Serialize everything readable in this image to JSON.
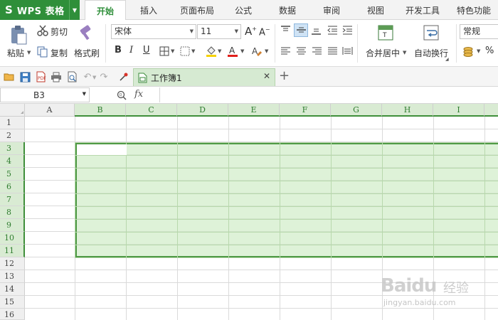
{
  "app": {
    "name": "WPS 表格",
    "logo": "S"
  },
  "menu": {
    "tabs": [
      {
        "label": "开始",
        "active": true
      },
      {
        "label": "插入"
      },
      {
        "label": "页面布局"
      },
      {
        "label": "公式"
      },
      {
        "label": "数据"
      },
      {
        "label": "审阅"
      },
      {
        "label": "视图"
      },
      {
        "label": "开发工具"
      },
      {
        "label": "特色功能"
      }
    ]
  },
  "ribbon": {
    "paste_label": "粘贴",
    "cut_label": "剪切",
    "copy_label": "复制",
    "format_painter_label": "格式刷",
    "font_name": "宋体",
    "font_size": "11",
    "bold": "B",
    "italic": "I",
    "underline": "U",
    "merge_center_label": "合并居中",
    "wrap_text_label": "自动换行",
    "number_format": "常规",
    "percent": "%"
  },
  "document": {
    "tab_title": "工作簿1"
  },
  "formula_bar": {
    "cell_ref": "B3",
    "fx": "fx",
    "formula": ""
  },
  "sheet": {
    "columns": [
      "A",
      "B",
      "C",
      "D",
      "E",
      "F",
      "G",
      "H",
      "I"
    ],
    "rows": [
      "1",
      "2",
      "3",
      "4",
      "5",
      "6",
      "7",
      "8",
      "9",
      "10",
      "11",
      "12",
      "13",
      "14",
      "15",
      "16"
    ],
    "selected_range": "B3:I11",
    "active_cell": "B3"
  },
  "watermark": {
    "brand": "Baidu",
    "cn": "经验",
    "url": "jingyan.baidu.com"
  },
  "colors": {
    "accent": "#2f8f3a",
    "selection_fill": "#d9ebd3",
    "selection_border": "#4f9a45"
  }
}
